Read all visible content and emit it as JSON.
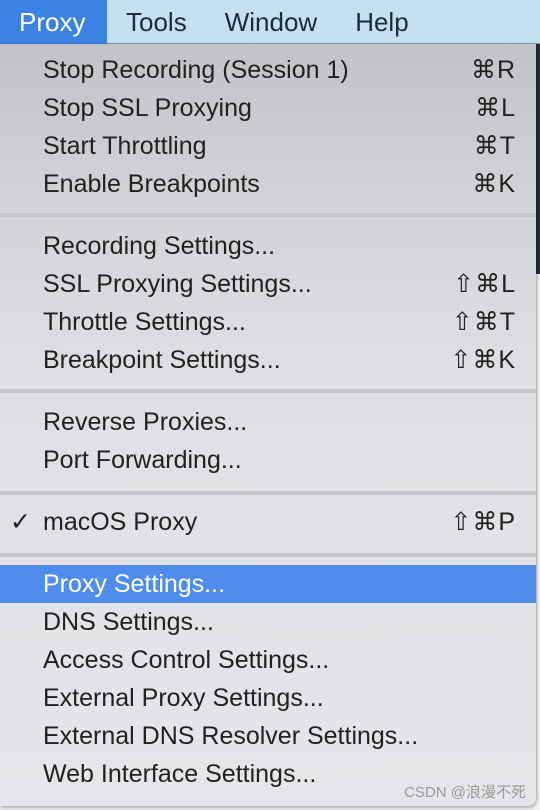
{
  "menubar": [
    "Proxy",
    "Tools",
    "Window",
    "Help"
  ],
  "menu": {
    "groups": [
      [
        {
          "label": "Stop Recording (Session 1)",
          "shortcut": "⌘R"
        },
        {
          "label": "Stop SSL Proxying",
          "shortcut": "⌘L"
        },
        {
          "label": "Start Throttling",
          "shortcut": "⌘T"
        },
        {
          "label": "Enable Breakpoints",
          "shortcut": "⌘K"
        }
      ],
      [
        {
          "label": "Recording Settings...",
          "shortcut": ""
        },
        {
          "label": "SSL Proxying Settings...",
          "shortcut": "⇧⌘L"
        },
        {
          "label": "Throttle Settings...",
          "shortcut": "⇧⌘T"
        },
        {
          "label": "Breakpoint Settings...",
          "shortcut": "⇧⌘K"
        }
      ],
      [
        {
          "label": "Reverse Proxies...",
          "shortcut": ""
        },
        {
          "label": "Port Forwarding...",
          "shortcut": ""
        }
      ],
      [
        {
          "label": "macOS Proxy",
          "shortcut": "⇧⌘P",
          "checked": true,
          "check": "✓"
        }
      ],
      [
        {
          "label": "Proxy Settings...",
          "shortcut": "",
          "highlighted": true
        },
        {
          "label": "DNS Settings...",
          "shortcut": ""
        },
        {
          "label": "Access Control Settings...",
          "shortcut": ""
        },
        {
          "label": "External Proxy Settings...",
          "shortcut": ""
        },
        {
          "label": "External DNS Resolver Settings...",
          "shortcut": ""
        },
        {
          "label": "Web Interface Settings...",
          "shortcut": ""
        }
      ]
    ]
  },
  "watermark": "CSDN @浪漫不死",
  "colors": {
    "highlight": "#4f8cec",
    "active_menu": "#3b82e2",
    "menubar": "#c5e0f3"
  }
}
